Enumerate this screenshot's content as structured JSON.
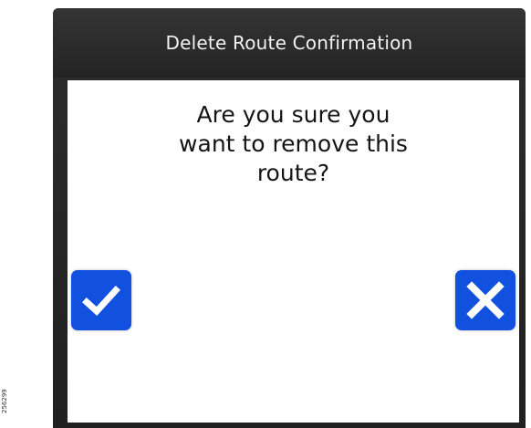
{
  "dialog": {
    "title": "Delete Route Confirmation",
    "message_lines": [
      "Are you sure you",
      "want to remove this",
      "route?"
    ]
  },
  "buttons": {
    "confirm_icon": "checkmark-icon",
    "cancel_icon": "x-close-icon",
    "button_color": "#1250e0"
  },
  "figure_id": "256299"
}
